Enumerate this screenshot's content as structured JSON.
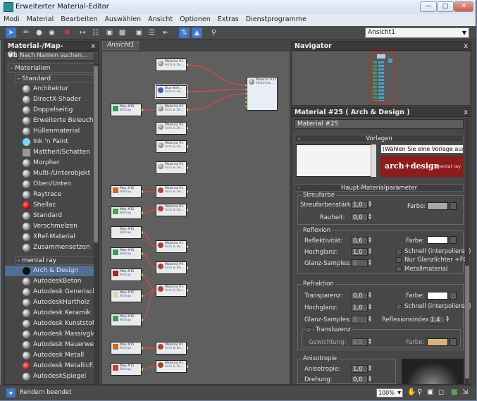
{
  "window": {
    "title": "Erweiterter Material-Editor"
  },
  "menu": [
    "Modi",
    "Material",
    "Bearbeiten",
    "Auswählen",
    "Ansicht",
    "Optionen",
    "Extras",
    "Dienstprogramme"
  ],
  "toolbar": {
    "view_selected": "Ansicht1"
  },
  "browser": {
    "title": "Material-/Map-Übersicht",
    "search_placeholder": "Nach Namen suchen...",
    "group_materials": "- Materialien",
    "group_standard": "- Standard",
    "standard_items": [
      "Architektur",
      "DirectX-Shader",
      "Doppelseitig",
      "Erweiterte Beleucht...",
      "Hüllenmaterial",
      "Ink 'n Paint",
      "Mattheit/Schatten",
      "Morpher",
      "Multi-/Unterobjekt",
      "Oben/Unten",
      "Raytrace",
      "Shellac",
      "Standard",
      "Verschmelzen",
      "XRef-Material",
      "Zusammensetzen"
    ],
    "group_mentalray": "- mental ray",
    "mentalray_items": [
      "Arch & Design",
      "AutodeskBeton",
      "Autodesk Generisch",
      "AutodeskHartholz",
      "Autodesk Keramik",
      "Autodesk Kunststoff...",
      "Autodesk Massivglas",
      "Autodesk Mauerwer...",
      "Autodesk Metall",
      "Autodesk MetallicF...",
      "AutodeskSpiegel"
    ]
  },
  "view": {
    "tab": "Ansicht1",
    "nodes": {
      "main_title": "Material #25",
      "main_sub": "Multi/Sub...",
      "sel_title": "Blue Refr...",
      "sel_sub": "Arch & De...",
      "map_title": "Map #15",
      "map_sub": "Bitmap",
      "mat_title": "Material #1",
      "mat_sub": "Arch & De..."
    }
  },
  "navigator": {
    "title": "Navigator"
  },
  "params": {
    "title": "Material #25  ( Arch & Design )",
    "name_value": "Material #25",
    "vorlagen": "Vorlagen",
    "vorlage_select": "(Wählen Sie eine Vorlage aus)",
    "logo_main": "arch+design",
    "logo_sub": "mental ray",
    "haupt": "Haupt-Materialparameter",
    "streufarbe_group": "Streufarbe",
    "streu_label": "Streufarbenstärke:",
    "streu_value": "1,0",
    "rauheit_label": "Rauheit:",
    "rauheit_value": "0,0",
    "farbe_label": "Farbe:",
    "reflexion_group": "Reflexion",
    "reflekt_label": "Reflektivität:",
    "reflekt_value": "0,6",
    "hochglanz_label": "Hochglanz:",
    "hochglanz_value": "1,0",
    "glanz_label": "Glanz-Samples:",
    "glanz_value": "8",
    "chk_schnell": "Schnell (interpolieren)",
    "chk_nur": "Nur Glanzlichter +FG",
    "chk_metall": "Metallmaterial",
    "refraktion_group": "Refraktion",
    "transparenz_label": "Transparenz:",
    "transparenz_value": "0,0",
    "r_hochglanz_label": "Hochglanz:",
    "r_hochglanz_value": "1,0",
    "r_glanz_label": "Glanz-Samples:",
    "r_glanz_value": "8",
    "r_schnell": "Schnell (interpolieren)",
    "reflexionsindex_label": "Reflexionsindex:",
    "reflexionsindex_value": "1,4",
    "transluzenz": "Transluzenz",
    "gewichtung_label": "Gewichtung:",
    "gewichtung_value": "0,5",
    "aniso_group": "Anisotropie",
    "aniso_label": "Anisotropie:",
    "aniso_value": "1,0",
    "drehung_label": "Drehung:",
    "drehung_value": "0,0",
    "colors": {
      "diffuse": "#a8a8a8",
      "reflection": "#ffffff",
      "refraction": "#ffffff",
      "translucency": "#d9b27a"
    }
  },
  "status": {
    "text": "Rendern beendet",
    "zoom": "100%"
  }
}
